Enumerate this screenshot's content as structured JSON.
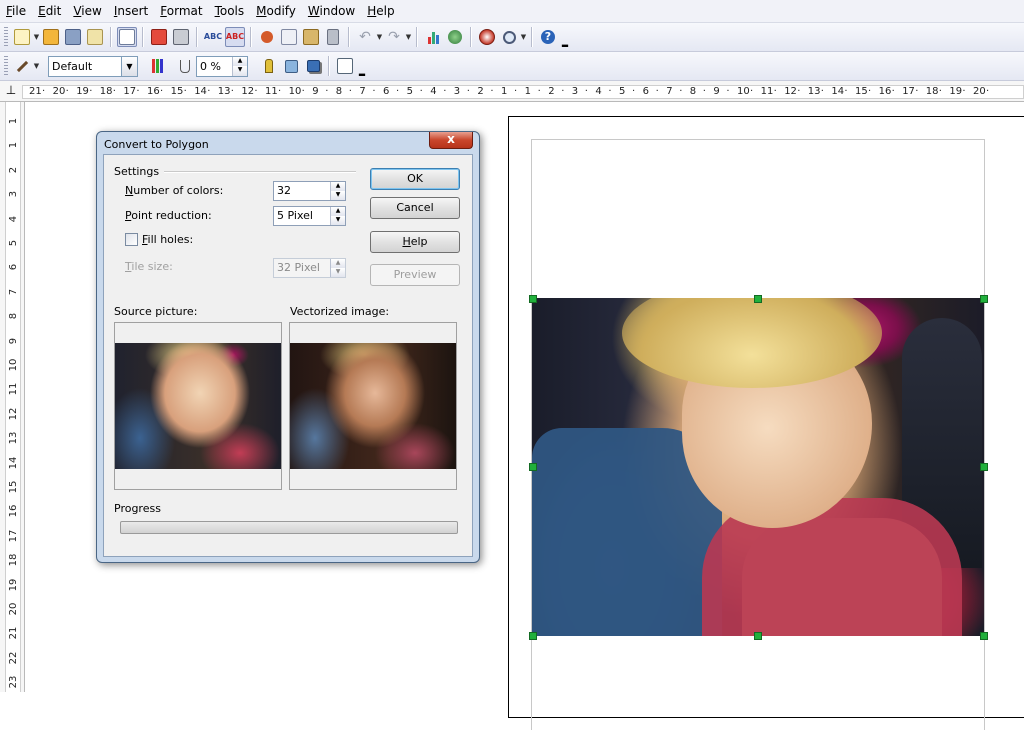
{
  "menu": [
    "File",
    "Edit",
    "View",
    "Insert",
    "Format",
    "Tools",
    "Modify",
    "Window",
    "Help"
  ],
  "toolbar2": {
    "style_value": "Default",
    "transparency_value": "0 %"
  },
  "ruler": {
    "horizontal_labels": [
      "21",
      "20",
      "19",
      "18",
      "17",
      "16",
      "15",
      "14",
      "13",
      "12",
      "11",
      "10",
      "9",
      "8",
      "7",
      "6",
      "5",
      "4",
      "3",
      "2",
      "1",
      "1",
      "2",
      "3",
      "4",
      "5",
      "6",
      "7",
      "8",
      "9",
      "10",
      "11",
      "12",
      "13",
      "14",
      "15",
      "16",
      "17",
      "18",
      "19",
      "20"
    ],
    "vertical_labels": [
      "1",
      "1",
      "2",
      "3",
      "4",
      "5",
      "6",
      "7",
      "8",
      "9",
      "10",
      "11",
      "12",
      "13",
      "14",
      "15",
      "16",
      "17",
      "18",
      "19",
      "20",
      "21",
      "22",
      "23"
    ]
  },
  "dialog": {
    "title": "Convert to Polygon",
    "close_label": "x",
    "settings_label": "Settings",
    "number_of_colors_label": "Number of colors:",
    "number_of_colors_value": "32",
    "point_reduction_label": "Point reduction:",
    "point_reduction_value": "5 Pixel",
    "fill_holes_label": "Fill holes:",
    "fill_holes_checked": false,
    "tile_size_label": "Tile size:",
    "tile_size_value": "32 Pixel",
    "ok_label": "OK",
    "cancel_label": "Cancel",
    "help_label": "Help",
    "preview_label": "Preview",
    "source_picture_label": "Source picture:",
    "vectorized_image_label": "Vectorized image:",
    "progress_label": "Progress",
    "progress_value": 0
  },
  "colors": {
    "accent": "#3c7fb1",
    "selection_handle": "#21b03c",
    "dialog_frame": "#c9d9ec"
  }
}
